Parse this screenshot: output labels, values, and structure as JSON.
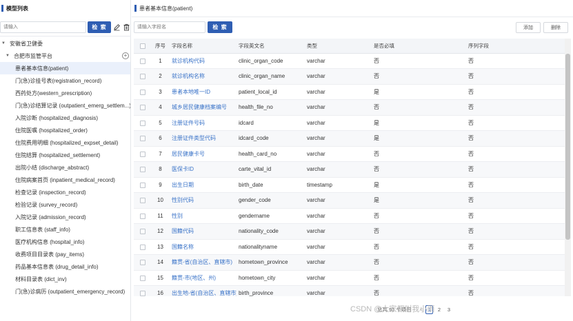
{
  "left": {
    "title": "模型列表",
    "search_placeholder": "请输入",
    "search_button": "检 索",
    "tree": {
      "root": "安徽省卫健委",
      "child": "合肥市监管平台",
      "items": [
        "患者基本信息(patient)",
        "门(急)诊挂号表(registration_record)",
        "西药处方(western_prescription)",
        "门(急)诊结算记录 (outpatient_emerg_settlem...)",
        "入院诊断 (hospitalized_diagnosis)",
        "住院医嘱 (hospitalized_order)",
        "住院费用明细 (hospitalized_expset_detail)",
        "住院结算 (hospitalized_settlement)",
        "出院小结 (discharge_abstract)",
        "住院病案首页 (inpatient_medical_record)",
        "检查记录 (inspection_record)",
        "检验记录 (survey_record)",
        "入院记录 (admission_record)",
        "职工信息表 (staff_info)",
        "医疗机构信息 (hospital_info)",
        "收费项目目录表 (pay_items)",
        "药品基本信息表 (drug_detail_info)",
        "材料目录表 (dict_inv)",
        "门(急)诊病历 (outpatient_emergency_record)"
      ]
    }
  },
  "right": {
    "title": "患者基本信息(patient)",
    "search_placeholder": "请输入字段名",
    "search_button": "检 索",
    "add_button": "添加",
    "delete_button": "删除",
    "columns": [
      "序号",
      "字段名称",
      "字段英文名",
      "类型",
      "是否必填",
      "序列字段"
    ],
    "rows": [
      [
        "1",
        "就诊机构代码",
        "clinic_organ_code",
        "varchar",
        "否",
        "否"
      ],
      [
        "2",
        "就诊机构名称",
        "clinic_organ_name",
        "varchar",
        "否",
        "否"
      ],
      [
        "3",
        "患者本地唯一ID",
        "patient_local_id",
        "varchar",
        "是",
        "否"
      ],
      [
        "4",
        "城乡居民健康档案编号",
        "health_file_no",
        "varchar",
        "否",
        "否"
      ],
      [
        "5",
        "注册证件号码",
        "idcard",
        "varchar",
        "是",
        "否"
      ],
      [
        "6",
        "注册证件类型代码",
        "idcard_code",
        "varchar",
        "是",
        "否"
      ],
      [
        "7",
        "居民健康卡号",
        "health_card_no",
        "varchar",
        "否",
        "否"
      ],
      [
        "8",
        "医保卡ID",
        "carte_vital_id",
        "varchar",
        "否",
        "否"
      ],
      [
        "9",
        "出生日期",
        "birth_date",
        "timestamp",
        "是",
        "否"
      ],
      [
        "10",
        "性别代码",
        "gender_code",
        "varchar",
        "是",
        "否"
      ],
      [
        "11",
        "性别",
        "gendername",
        "varchar",
        "否",
        "否"
      ],
      [
        "12",
        "国籍代码",
        "nationality_code",
        "varchar",
        "否",
        "否"
      ],
      [
        "13",
        "国籍名称",
        "nationalityname",
        "varchar",
        "否",
        "否"
      ],
      [
        "14",
        "籍贯-省(自治区、直辖市)",
        "hometown_province",
        "varchar",
        "否",
        "否"
      ],
      [
        "15",
        "籍贯-市(地区、州)",
        "hometown_city",
        "varchar",
        "否",
        "否"
      ],
      [
        "16",
        "出生地-省(自治区、直辖市)",
        "birth_province",
        "varchar",
        "否",
        "否"
      ]
    ],
    "pager": {
      "total": "总共 91 个项目",
      "prev": "<",
      "pages": [
        "1",
        "2",
        "3"
      ]
    }
  },
  "watermark": "CSDN @大家都叫我小雨"
}
